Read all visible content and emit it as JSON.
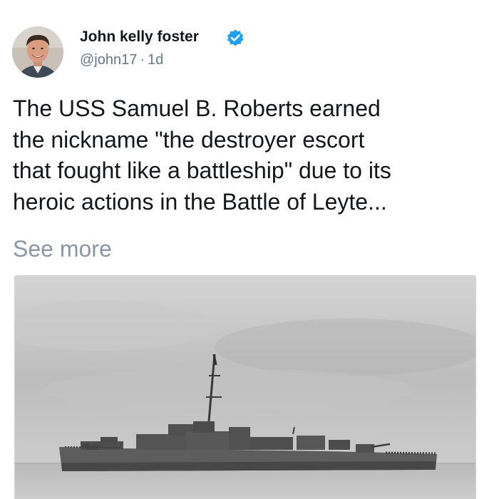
{
  "tweet": {
    "author": {
      "display_name": "John kelly foster",
      "handle": "@john17",
      "verified": true
    },
    "time_ago": "1d",
    "separator": "·",
    "text_lines": [
      "The USS Samuel B. Roberts earned",
      "the nickname \"the destroyer escort",
      "that fought like a battleship\" due to its",
      "heroic actions in the Battle of Leyte..."
    ],
    "see_more_label": "See more",
    "media": {
      "kind": "photo",
      "subject": "warship",
      "palette": "grayscale"
    }
  },
  "colors": {
    "verified_blue": "#1da1f2",
    "name_text": "#14171a",
    "secondary_text": "#657786",
    "see_more_text": "#8a96a1"
  },
  "icons": {
    "verified": "verified-badge-icon",
    "avatar": "profile-photo"
  }
}
